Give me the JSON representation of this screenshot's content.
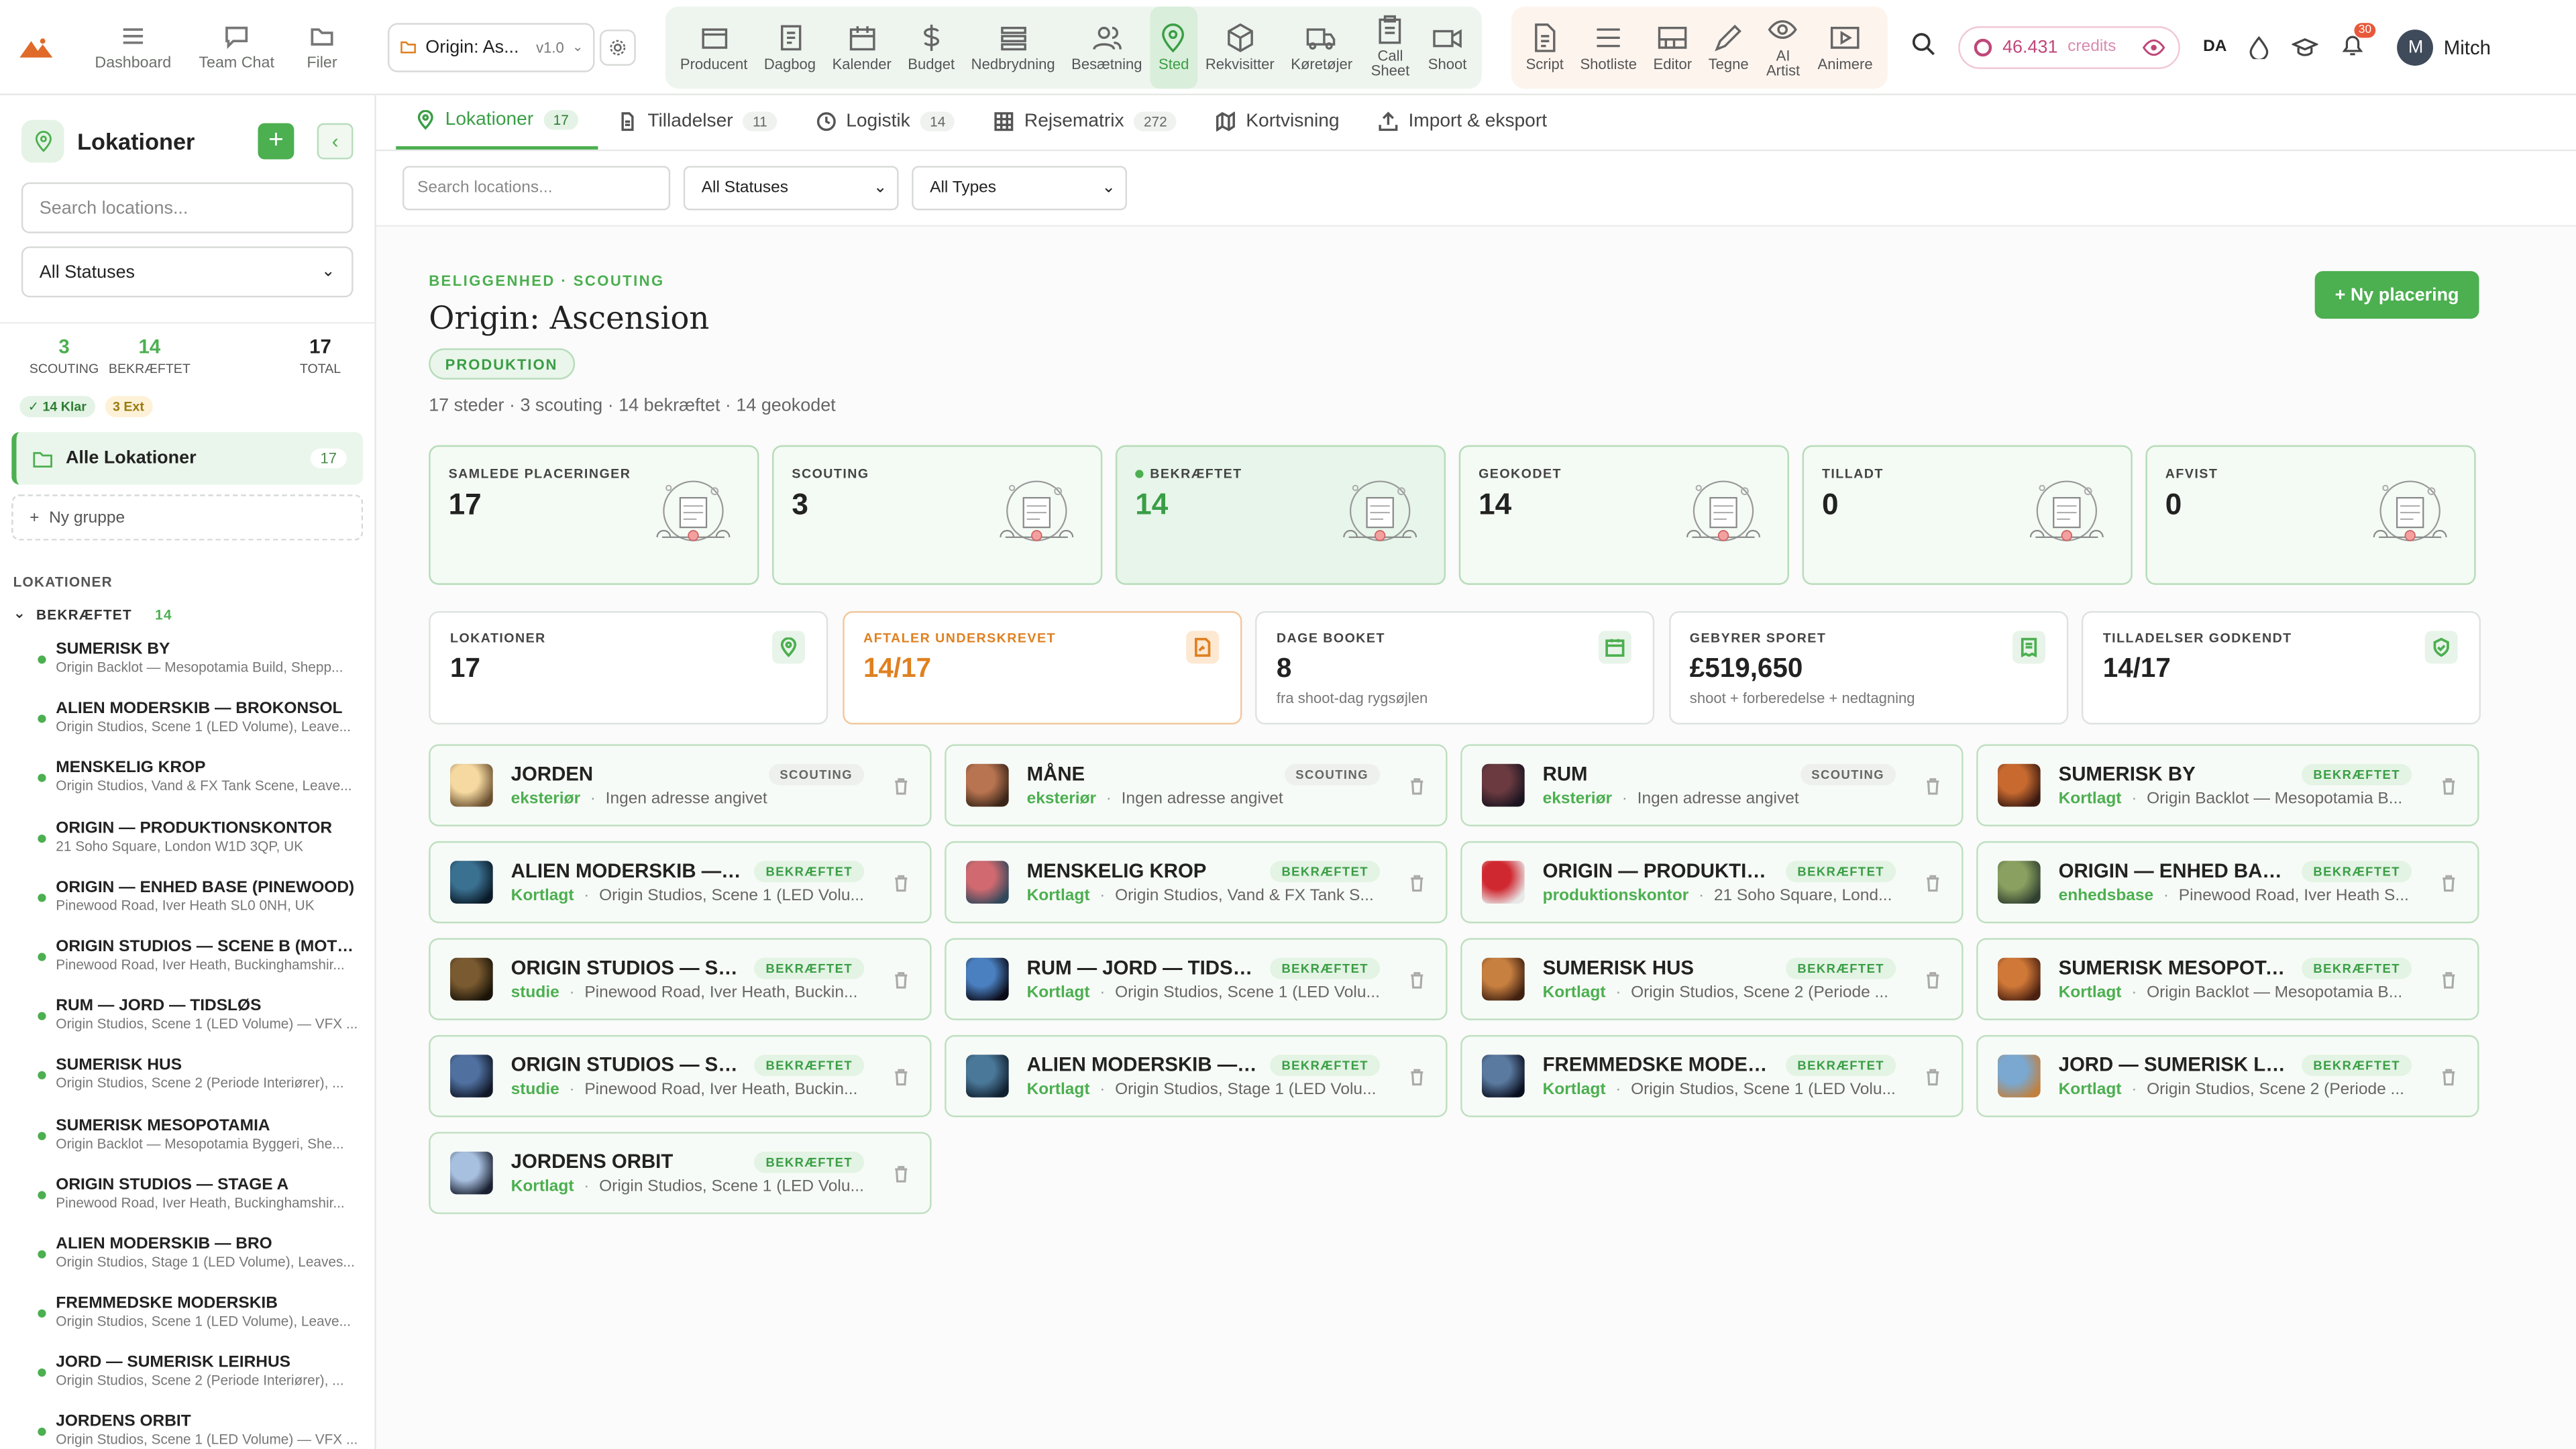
{
  "topbar": {
    "nav": [
      {
        "label": "Dashboard",
        "icon": "menu-icon"
      },
      {
        "label": "Team Chat",
        "icon": "chat-icon"
      },
      {
        "label": "Filer",
        "icon": "folder-icon"
      }
    ],
    "project": {
      "name": "Origin: As...",
      "version": "v1.0"
    },
    "tools_main": [
      {
        "label": "Producent",
        "icon": "producer-icon"
      },
      {
        "label": "Dagbog",
        "icon": "diary-icon"
      },
      {
        "label": "Kalender",
        "icon": "calendar-icon"
      },
      {
        "label": "Budget",
        "icon": "dollar-icon"
      },
      {
        "label": "Nedbrydning",
        "icon": "breakdown-icon"
      },
      {
        "label": "Besætning",
        "icon": "crew-icon"
      },
      {
        "label": "Sted",
        "icon": "location-pin-icon",
        "active": true
      },
      {
        "label": "Rekvisitter",
        "icon": "props-icon"
      },
      {
        "label": "Køretøjer",
        "icon": "vehicle-icon"
      },
      {
        "label": "Call Sheet",
        "icon": "clipboard-icon"
      },
      {
        "label": "Shoot",
        "icon": "camera-icon"
      }
    ],
    "tools_creative": [
      {
        "label": "Script",
        "icon": "script-icon"
      },
      {
        "label": "Shotliste",
        "icon": "list-icon"
      },
      {
        "label": "Editor",
        "icon": "editor-icon"
      },
      {
        "label": "Tegne",
        "icon": "pen-icon"
      },
      {
        "label": "AI Artist",
        "icon": "eye-icon"
      },
      {
        "label": "Animere",
        "icon": "play-icon"
      }
    ],
    "credits": {
      "value": "46.431",
      "label": "credits"
    },
    "language": "DA",
    "notifications": "30",
    "user": {
      "initial": "M",
      "name": "Mitch"
    }
  },
  "sidebar": {
    "title": "Lokationer",
    "search_placeholder": "Search locations...",
    "status_filter": "All Statuses",
    "stats": [
      {
        "value": "3",
        "label": "SCOUTING"
      },
      {
        "value": "14",
        "label": "BEKRÆFTET"
      },
      {
        "value": "17",
        "label": "TOTAL"
      }
    ],
    "badges": [
      "✓ 14 Klar",
      "3 Ext"
    ],
    "all_label": "Alle Lokationer",
    "all_count": "17",
    "new_group": "Ny gruppe",
    "section_label": "LOKATIONER",
    "group": {
      "label": "BEKRÆFTET",
      "count": "14"
    },
    "items": [
      {
        "name": "SUMERISK BY",
        "sub": "Origin Backlot — Mesopotamia Build, Shepp..."
      },
      {
        "name": "ALIEN MODERSKIB — BROKONSOL",
        "sub": "Origin Studios, Scene 1 (LED Volume), Leave..."
      },
      {
        "name": "MENSKELIG KROP",
        "sub": "Origin Studios, Vand & FX Tank Scene, Leave..."
      },
      {
        "name": "ORIGIN — PRODUKTIONSKONTOR",
        "sub": "21 Soho Square, London W1D 3QP, UK"
      },
      {
        "name": "ORIGIN — ENHED BASE (PINEWOOD)",
        "sub": "Pinewood Road, Iver Heath SL0 0NH, UK"
      },
      {
        "name": "ORIGIN STUDIOS — SCENE B (MOTH...",
        "sub": "Pinewood Road, Iver Heath, Buckinghamshir..."
      },
      {
        "name": "RUM — JORD — TIDSLØS",
        "sub": "Origin Studios, Scene 1 (LED Volume) — VFX ..."
      },
      {
        "name": "SUMERISK HUS",
        "sub": "Origin Studios, Scene 2 (Periode Interiører), ..."
      },
      {
        "name": "SUMERISK MESOPOTAMIA",
        "sub": "Origin Backlot — Mesopotamia Byggeri, She..."
      },
      {
        "name": "ORIGIN STUDIOS — STAGE A",
        "sub": "Pinewood Road, Iver Heath, Buckinghamshir..."
      },
      {
        "name": "ALIEN MODERSKIB — BRO",
        "sub": "Origin Studios, Stage 1 (LED Volume), Leaves..."
      },
      {
        "name": "FREMMEDSKE MODERSKIB",
        "sub": "Origin Studios, Scene 1 (LED Volume), Leave..."
      },
      {
        "name": "JORD — SUMERISK LEIRHUS",
        "sub": "Origin Studios, Scene 2 (Periode Interiører), ..."
      },
      {
        "name": "JORDENS ORBIT",
        "sub": "Origin Studios, Scene 1 (LED Volume) — VFX ..."
      }
    ]
  },
  "tabs": [
    {
      "label": "Lokationer",
      "count": "17",
      "active": true
    },
    {
      "label": "Tilladelser",
      "count": "11"
    },
    {
      "label": "Logistik",
      "count": "14"
    },
    {
      "label": "Rejsematrix",
      "count": "272"
    },
    {
      "label": "Kortvisning",
      "count": ""
    },
    {
      "label": "Import & eksport",
      "count": ""
    }
  ],
  "filters": {
    "search_placeholder": "Search locations...",
    "status": "All Statuses",
    "type": "All Types"
  },
  "page": {
    "breadcrumb": "BELIGGENHED · SCOUTING",
    "title": "Origin: Ascension",
    "badge": "PRODUKTION",
    "summary": "17 steder · 3 scouting · 14 bekræftet · 14 geokodet",
    "new_button": "+ Ny placering"
  },
  "status_cards": [
    {
      "label": "SAMLEDE PLACERINGER",
      "value": "17"
    },
    {
      "label": "SCOUTING",
      "value": "3"
    },
    {
      "label": "BEKRÆFTET",
      "value": "14",
      "highlight": true
    },
    {
      "label": "GEOKODET",
      "value": "14"
    },
    {
      "label": "TILLADT",
      "value": "0"
    },
    {
      "label": "AFVIST",
      "value": "0"
    }
  ],
  "metric_cards": [
    {
      "label": "LOKATIONER",
      "value": "17",
      "sub": "",
      "icon": "location-pin-icon"
    },
    {
      "label": "AFTALER UNDERSKREVET",
      "value": "14/17",
      "sub": "",
      "icon": "signed-doc-icon",
      "accent": "orange"
    },
    {
      "label": "DAGE BOOKET",
      "value": "8",
      "sub": "fra shoot-dag rygsøjlen",
      "icon": "calendar-icon"
    },
    {
      "label": "GEBYRER SPORET",
      "value": "£519,650",
      "sub": "shoot + forberedelse + nedtagning",
      "icon": "receipt-icon"
    },
    {
      "label": "TILLADELSER GODKENDT",
      "value": "14/17",
      "sub": "",
      "icon": "shield-check-icon"
    }
  ],
  "locations": [
    {
      "name": "JORDEN",
      "status": "SCOUTING",
      "type": "eksteriør",
      "address": "Ingen adresse angivet",
      "thumb": [
        "#f5d9a0",
        "#6a5030"
      ]
    },
    {
      "name": "MÅNE",
      "status": "SCOUTING",
      "type": "eksteriør",
      "address": "Ingen adresse angivet",
      "thumb": [
        "#b87450",
        "#3a2518"
      ]
    },
    {
      "name": "RUM",
      "status": "SCOUTING",
      "type": "eksteriør",
      "address": "Ingen adresse angivet",
      "thumb": [
        "#6a3a40",
        "#1a1420"
      ]
    },
    {
      "name": "SUMERISK BY",
      "status": "BEKRÆFTET",
      "type": "Kortlagt",
      "address": "Origin Backlot — Mesopotamia B...",
      "thumb": [
        "#c86a30",
        "#3a1a10"
      ]
    },
    {
      "name": "ALIEN MODERSKIB — B...",
      "status": "BEKRÆFTET",
      "type": "Kortlagt",
      "address": "Origin Studios, Scene 1 (LED Volu...",
      "thumb": [
        "#3a7090",
        "#0a1a28"
      ]
    },
    {
      "name": "MENSKELIG KROP",
      "status": "BEKRÆFTET",
      "type": "Kortlagt",
      "address": "Origin Studios, Vand & FX Tank S...",
      "thumb": [
        "#d06a70",
        "#30485a"
      ]
    },
    {
      "name": "ORIGIN — PRODUKTIO...",
      "status": "BEKRÆFTET",
      "type": "produktionskontor",
      "address": "21 Soho Square, Lond...",
      "thumb": [
        "#d02830",
        "#e8e8e8"
      ]
    },
    {
      "name": "ORIGIN — ENHED BASE ...",
      "status": "BEKRÆFTET",
      "type": "enhedsbase",
      "address": "Pinewood Road, Iver Heath S...",
      "thumb": [
        "#8aa060",
        "#304030"
      ]
    },
    {
      "name": "ORIGIN STUDIOS — SCE...",
      "status": "BEKRÆFTET",
      "type": "studie",
      "address": "Pinewood Road, Iver Heath, Buckin...",
      "thumb": [
        "#7a5a30",
        "#1a1408"
      ]
    },
    {
      "name": "RUM — JORD — TIDSLØS",
      "status": "BEKRÆFTET",
      "type": "Kortlagt",
      "address": "Origin Studios, Scene 1 (LED Volu...",
      "thumb": [
        "#4a80c0",
        "#0a0a18"
      ]
    },
    {
      "name": "SUMERISK HUS",
      "status": "BEKRÆFTET",
      "type": "Kortlagt",
      "address": "Origin Studios, Scene 2 (Periode ...",
      "thumb": [
        "#c88040",
        "#402010"
      ]
    },
    {
      "name": "SUMERISK MESOPOTAM...",
      "status": "BEKRÆFTET",
      "type": "Kortlagt",
      "address": "Origin Backlot — Mesopotamia B...",
      "thumb": [
        "#d07838",
        "#4a2010"
      ]
    },
    {
      "name": "ORIGIN STUDIOS — STA...",
      "status": "BEKRÆFTET",
      "type": "studie",
      "address": "Pinewood Road, Iver Heath, Buckin...",
      "thumb": [
        "#5070a0",
        "#101828"
      ]
    },
    {
      "name": "ALIEN MODERSKIB — B...",
      "status": "BEKRÆFTET",
      "type": "Kortlagt",
      "address": "Origin Studios, Stage 1 (LED Volu...",
      "thumb": [
        "#4a7898",
        "#102030"
      ]
    },
    {
      "name": "FREMMEDSKE MODERS...",
      "status": "BEKRÆFTET",
      "type": "Kortlagt",
      "address": "Origin Studios, Scene 1 (LED Volu...",
      "thumb": [
        "#5a7aa0",
        "#0a0f20"
      ]
    },
    {
      "name": "JORD — SUMERISK LEIR...",
      "status": "BEKRÆFTET",
      "type": "Kortlagt",
      "address": "Origin Studios, Scene 2 (Periode ...",
      "thumb": [
        "#7aa8d0",
        "#c08040"
      ]
    },
    {
      "name": "JORDENS ORBIT",
      "status": "BEKRÆFTET",
      "type": "Kortlagt",
      "address": "Origin Studios, Scene 1 (LED Volu...",
      "thumb": [
        "#a8c0e0",
        "#1a2030"
      ]
    }
  ],
  "colors": {
    "accent": "#4caf50",
    "warning": "#e08020",
    "credits": "#c0467a"
  }
}
